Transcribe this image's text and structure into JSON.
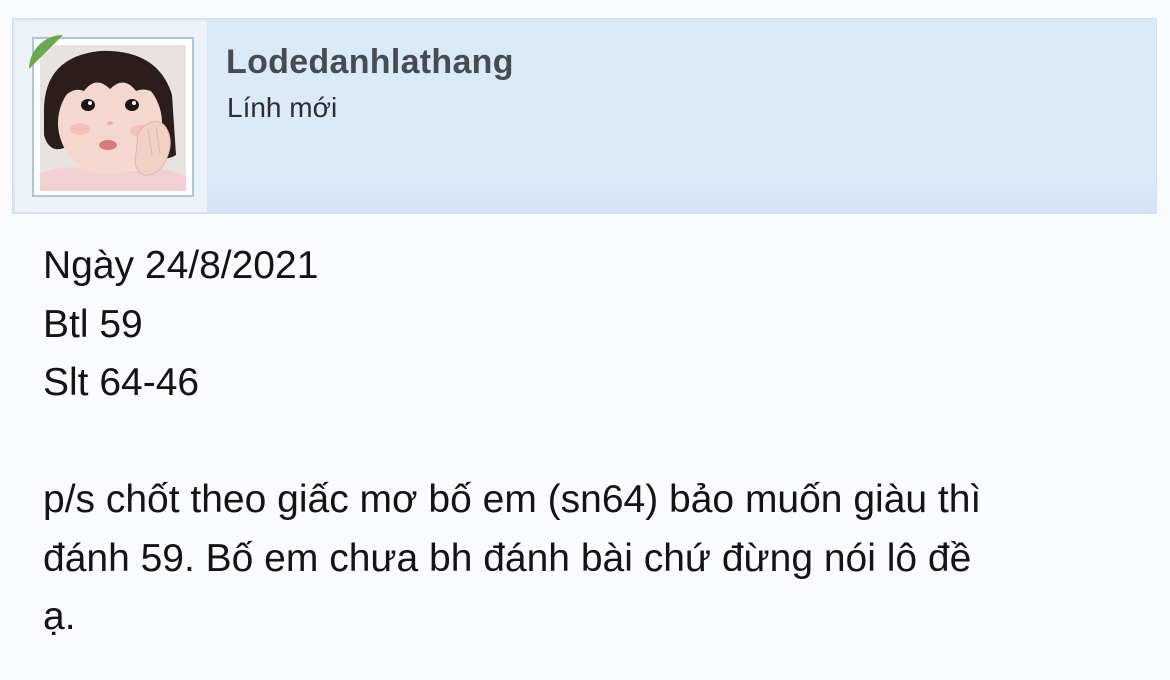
{
  "post": {
    "user": {
      "username": "Lodedanhlathang",
      "title": "Lính mới",
      "online_badge_color": "#6aa84f",
      "avatar_icon": "child-photo-avatar"
    },
    "message": {
      "lines": [
        "Ngày 24/8/2021",
        "Btl 59",
        "Slt 64-46",
        "",
        "p/s chốt theo giấc mơ bố em (sn64) bảo muốn giàu thì",
        "đánh 59. Bố em chưa bh đánh bài chứ đừng nói lô đề",
        "ạ."
      ]
    }
  }
}
